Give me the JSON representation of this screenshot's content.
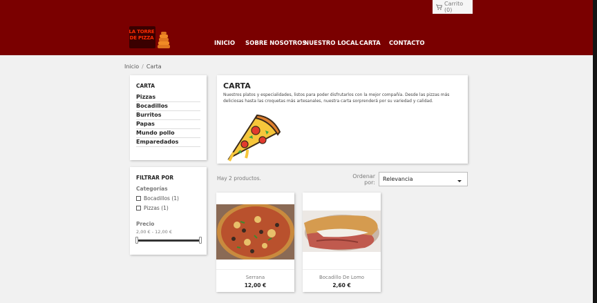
{
  "cart": {
    "label": "Carrito (0)"
  },
  "logo": {
    "line1": "LA TORRE",
    "line2": "DE PIZZA"
  },
  "nav": {
    "items": [
      "INICIO",
      "SOBRE NOSOTROS",
      "NUESTRO LOCAL",
      "CARTA",
      "CONTACTO"
    ]
  },
  "breadcrumb": {
    "home": "Inicio",
    "separator": "/",
    "current": "Carta"
  },
  "categories": {
    "title": "CARTA",
    "items": [
      "Pizzas",
      "Bocadillos",
      "Burritos",
      "Papas",
      "Mundo pollo",
      "Emparedados"
    ]
  },
  "filters": {
    "title": "FILTRAR POR",
    "categories_title": "Categorías",
    "options": [
      "Bocadillos (1)",
      "Pizzas (1)"
    ],
    "price_title": "Precio",
    "price_range": "2,00 € - 12,00 €"
  },
  "category_block": {
    "title": "CARTA",
    "description": "Nuestros platos y especialidades, listos para poder disfrutarlos con la mejor compañía. Desde las pizzas más deliciosas hasta las croquetas más artesanales, nuestra carta sorprenderá por su variedad y calidad."
  },
  "listing": {
    "count_text": "Hay 2 productos.",
    "sort_label_1": "Ordenar",
    "sort_label_2": "por:",
    "sort_value": "Relevancia"
  },
  "products": [
    {
      "name": "Serrana",
      "price": "12,00 €"
    },
    {
      "name": "Bocadillo De Lomo",
      "price": "2,60 €"
    }
  ],
  "colors": {
    "brand": "#7a0000",
    "background": "#f1f1f1",
    "accent": "#ff2b00"
  }
}
